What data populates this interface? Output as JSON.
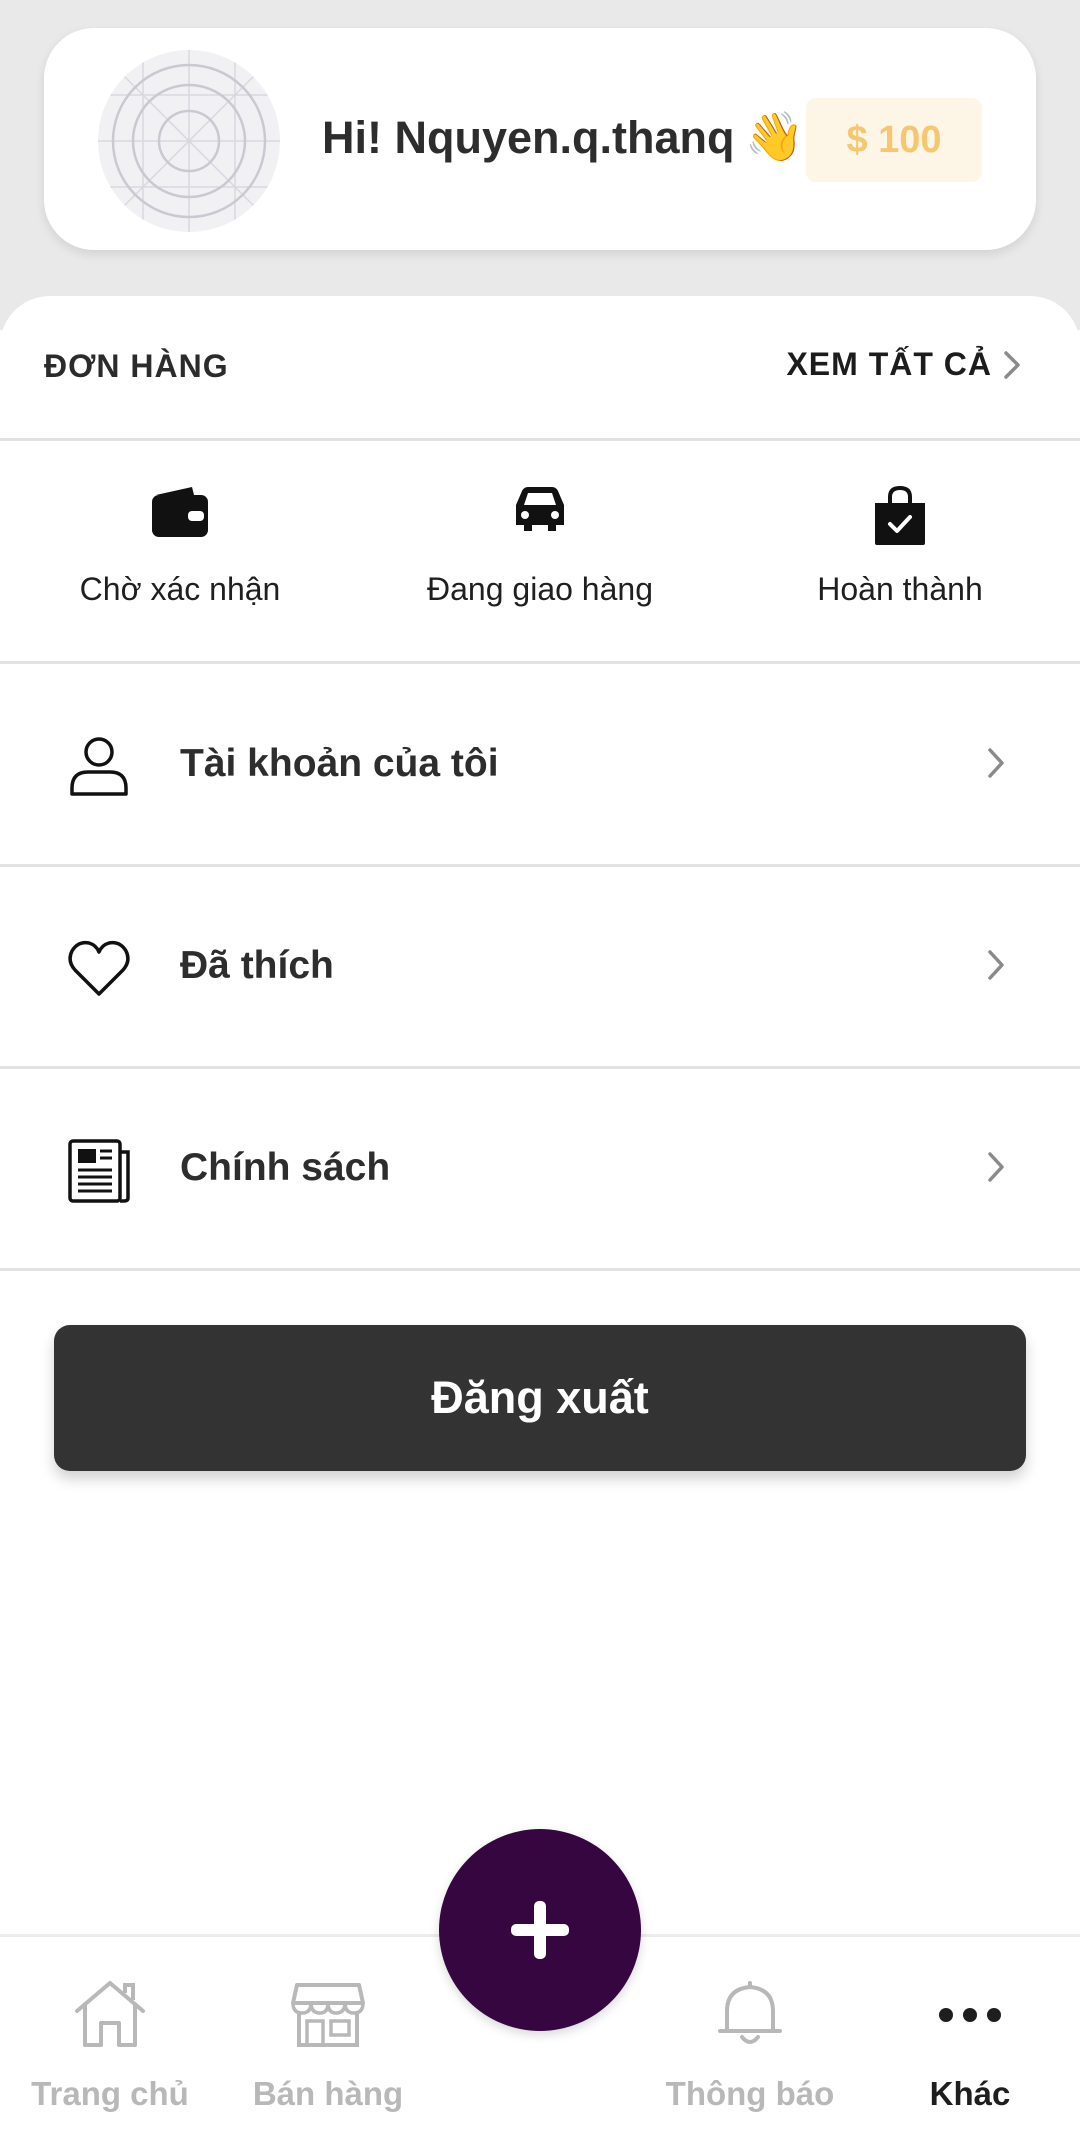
{
  "profile": {
    "greeting": "Hi! Nquyen.q.thanq",
    "wave_emoji": "👋",
    "balance": "$ 100"
  },
  "orders": {
    "title": "ĐƠN HÀNG",
    "view_all": "XEM TẤT CẢ",
    "statuses": [
      {
        "label": "Chờ xác nhận",
        "icon": "wallet-icon"
      },
      {
        "label": "Đang giao hàng",
        "icon": "car-icon"
      },
      {
        "label": "Hoàn thành",
        "icon": "shopping-bag-check-icon"
      }
    ]
  },
  "menu": [
    {
      "label": "Tài khoản của tôi",
      "icon": "user-icon"
    },
    {
      "label": "Đã thích",
      "icon": "heart-icon"
    },
    {
      "label": "Chính sách",
      "icon": "newspaper-icon"
    }
  ],
  "logout_label": "Đăng xuất",
  "bottom_nav": [
    {
      "label": "Trang chủ",
      "icon": "home-icon",
      "active": false
    },
    {
      "label": "Bán hàng",
      "icon": "store-icon",
      "active": false
    },
    {
      "label": "Thông báo",
      "icon": "bell-icon",
      "active": false
    },
    {
      "label": "Khác",
      "icon": "more-dots-icon",
      "active": true
    }
  ],
  "colors": {
    "fab": "#360640",
    "logout_button": "#333333",
    "balance_text": "#f6c771",
    "balance_bg": "#fdf5e6",
    "nav_inactive": "#b8b8b8",
    "nav_active": "#1e1e1e"
  }
}
